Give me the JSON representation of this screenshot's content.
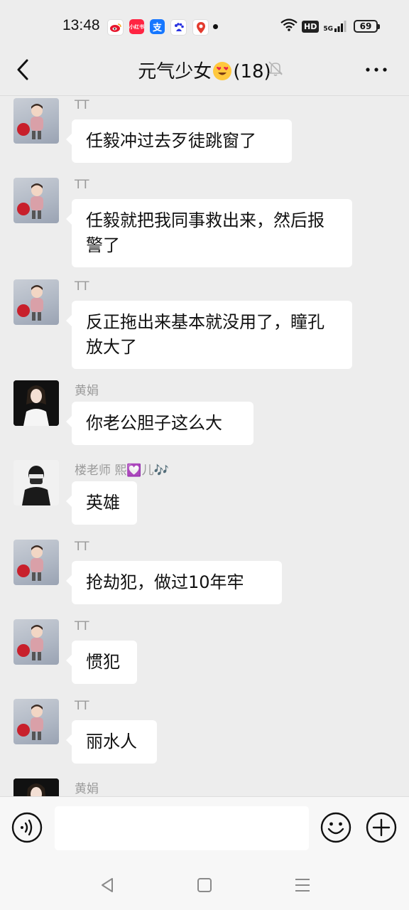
{
  "status_bar": {
    "time": "13:48",
    "app_icons": [
      {
        "name": "weibo-icon",
        "label": "",
        "color": "#e6162d"
      },
      {
        "name": "xiaohongshu-icon",
        "label": "小红书",
        "color": "#ff2442"
      },
      {
        "name": "alipay-icon",
        "label": "支",
        "color": "#1677ff"
      },
      {
        "name": "baidu-icon",
        "label": "",
        "color": "#2932e1"
      },
      {
        "name": "map-pin-icon",
        "label": "",
        "color": "#e33b2e"
      }
    ],
    "hd_label": "HD",
    "network_label": "5G",
    "battery": "69"
  },
  "header": {
    "title_main": "元气少女",
    "title_count": "(18)",
    "title_emoji": "heart-eyes-emoji"
  },
  "messages": [
    {
      "sender": "TT",
      "text": "任毅冲过去歹徒跳窗了",
      "avatar": "boy"
    },
    {
      "sender": "TT",
      "text": "任毅就把我同事救出来，然后报警了",
      "avatar": "boy"
    },
    {
      "sender": "TT",
      "text": "反正拖出来基本就没用了，瞳孔放大了",
      "avatar": "boy"
    },
    {
      "sender": "黄娟",
      "text": "你老公胆子这么大",
      "avatar": "girl"
    },
    {
      "sender": "楼老师 熙💟儿🎶",
      "text": "英雄",
      "avatar": "mask"
    },
    {
      "sender": "TT",
      "text": "抢劫犯，做过10年牢",
      "avatar": "boy"
    },
    {
      "sender": "TT",
      "text": "惯犯",
      "avatar": "boy"
    },
    {
      "sender": "TT",
      "text": "丽水人",
      "avatar": "boy"
    },
    {
      "sender": "黄娟",
      "text": "",
      "avatar": "girl"
    }
  ],
  "input": {
    "placeholder": ""
  },
  "colors": {
    "background": "#ededed",
    "bubble": "#ffffff",
    "sender_text": "#9a9a9a",
    "input_bar": "#f7f7f7"
  }
}
